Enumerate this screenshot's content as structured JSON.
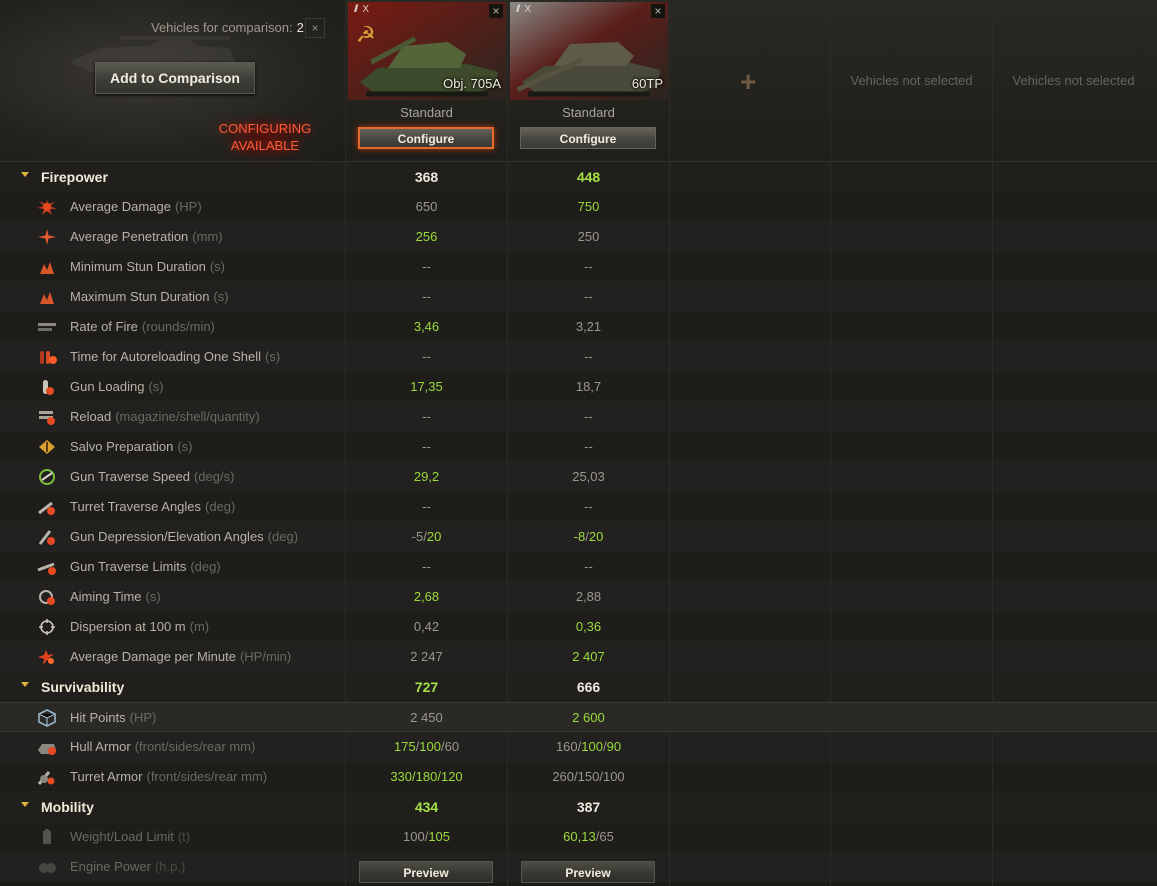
{
  "header": {
    "vehicles_label": "Vehicles for comparison:",
    "vehicles_count": "2",
    "clear_icon": "×",
    "add_button": "Add to Comparison",
    "configuring_line1": "CONFIGURING",
    "configuring_line2": "AVAILABLE",
    "add_slot_icon": "+",
    "empty_slot_text": "Vehicles not selected"
  },
  "vehicles": [
    {
      "tier": "X",
      "name": "Obj. 705A",
      "config": "Standard",
      "configure_button": "Configure",
      "preview_button": "Preview",
      "close_icon": "×",
      "flag": "ussr"
    },
    {
      "tier": "X",
      "name": "60TP",
      "config": "Standard",
      "configure_button": "Configure",
      "preview_button": "Preview",
      "close_icon": "×",
      "flag": "poland"
    }
  ],
  "colors": {
    "better": "#9bdb3a",
    "neutral": "#9a978d",
    "accent": "#e1b640",
    "highlight": "#e36a2c"
  },
  "rows": [
    {
      "type": "section",
      "label": "Firepower",
      "v1": [
        {
          "t": "368",
          "c": "w"
        }
      ],
      "v2": [
        {
          "t": "448",
          "c": "g"
        }
      ]
    },
    {
      "type": "stat",
      "icon": "damage-icon",
      "label": "Average Damage",
      "unit": "(HP)",
      "v1": [
        {
          "t": "650",
          "c": "w"
        }
      ],
      "v2": [
        {
          "t": "750",
          "c": "g"
        }
      ]
    },
    {
      "type": "stat",
      "icon": "penetration-icon",
      "label": "Average Penetration",
      "unit": "(mm)",
      "v1": [
        {
          "t": "256",
          "c": "g"
        }
      ],
      "v2": [
        {
          "t": "250",
          "c": "w"
        }
      ]
    },
    {
      "type": "stat",
      "icon": "stun-min-icon",
      "label": "Minimum Stun Duration",
      "unit": "(s)",
      "v1": [
        {
          "t": "--",
          "c": "w"
        }
      ],
      "v2": [
        {
          "t": "--",
          "c": "w"
        }
      ]
    },
    {
      "type": "stat",
      "icon": "stun-max-icon",
      "label": "Maximum Stun Duration",
      "unit": "(s)",
      "v1": [
        {
          "t": "--",
          "c": "w"
        }
      ],
      "v2": [
        {
          "t": "--",
          "c": "w"
        }
      ]
    },
    {
      "type": "stat",
      "icon": "rate-of-fire-icon",
      "label": "Rate of Fire",
      "unit": "(rounds/min)",
      "v1": [
        {
          "t": "3,46",
          "c": "g"
        }
      ],
      "v2": [
        {
          "t": "3,21",
          "c": "w"
        }
      ]
    },
    {
      "type": "stat",
      "icon": "autoreload-icon",
      "label": "Time for Autoreloading One Shell",
      "unit": "(s)",
      "v1": [
        {
          "t": "--",
          "c": "w"
        }
      ],
      "v2": [
        {
          "t": "--",
          "c": "w"
        }
      ]
    },
    {
      "type": "stat",
      "icon": "gun-loading-icon",
      "label": "Gun Loading",
      "unit": "(s)",
      "v1": [
        {
          "t": "17,35",
          "c": "g"
        }
      ],
      "v2": [
        {
          "t": "18,7",
          "c": "w"
        }
      ]
    },
    {
      "type": "stat",
      "icon": "reload-magazine-icon",
      "label": "Reload",
      "unit": "(magazine/shell/quantity)",
      "v1": [
        {
          "t": "--",
          "c": "w"
        }
      ],
      "v2": [
        {
          "t": "--",
          "c": "w"
        }
      ]
    },
    {
      "type": "stat",
      "icon": "salvo-icon",
      "label": "Salvo Preparation",
      "unit": "(s)",
      "v1": [
        {
          "t": "--",
          "c": "w"
        }
      ],
      "v2": [
        {
          "t": "--",
          "c": "w"
        }
      ]
    },
    {
      "type": "stat",
      "icon": "gun-traverse-icon",
      "label": "Gun Traverse Speed",
      "unit": "(deg/s)",
      "v1": [
        {
          "t": "29,2",
          "c": "g"
        }
      ],
      "v2": [
        {
          "t": "25,03",
          "c": "w"
        }
      ]
    },
    {
      "type": "stat",
      "icon": "turret-angles-icon",
      "label": "Turret Traverse Angles",
      "unit": "(deg)",
      "v1": [
        {
          "t": "--",
          "c": "w"
        }
      ],
      "v2": [
        {
          "t": "--",
          "c": "w"
        }
      ]
    },
    {
      "type": "stat",
      "icon": "elevation-icon",
      "label": "Gun Depression/Elevation Angles",
      "unit": "(deg)",
      "v1": [
        {
          "t": "-5",
          "c": "w"
        },
        {
          "t": "/",
          "c": "w"
        },
        {
          "t": "20",
          "c": "g"
        }
      ],
      "v2": [
        {
          "t": "-8",
          "c": "g"
        },
        {
          "t": "/",
          "c": "w"
        },
        {
          "t": "20",
          "c": "g"
        }
      ]
    },
    {
      "type": "stat",
      "icon": "traverse-limits-icon",
      "label": "Gun Traverse Limits",
      "unit": "(deg)",
      "v1": [
        {
          "t": "--",
          "c": "w"
        }
      ],
      "v2": [
        {
          "t": "--",
          "c": "w"
        }
      ]
    },
    {
      "type": "stat",
      "icon": "aiming-time-icon",
      "label": "Aiming Time",
      "unit": "(s)",
      "v1": [
        {
          "t": "2,68",
          "c": "g"
        }
      ],
      "v2": [
        {
          "t": "2,88",
          "c": "w"
        }
      ]
    },
    {
      "type": "stat",
      "icon": "dispersion-icon",
      "label": "Dispersion at 100 m",
      "unit": "(m)",
      "v1": [
        {
          "t": "0,42",
          "c": "w"
        }
      ],
      "v2": [
        {
          "t": "0,36",
          "c": "g"
        }
      ]
    },
    {
      "type": "stat",
      "icon": "dpm-icon",
      "label": "Average Damage per Minute",
      "unit": "(HP/min)",
      "v1": [
        {
          "t": "2 247",
          "c": "w"
        }
      ],
      "v2": [
        {
          "t": "2 407",
          "c": "g"
        }
      ]
    },
    {
      "type": "section",
      "label": "Survivability",
      "v1": [
        {
          "t": "727",
          "c": "g"
        }
      ],
      "v2": [
        {
          "t": "666",
          "c": "w"
        }
      ]
    },
    {
      "type": "stat",
      "icon": "hit-points-icon",
      "label": "Hit Points",
      "unit": "(HP)",
      "hover": true,
      "v1": [
        {
          "t": "2 450",
          "c": "w"
        }
      ],
      "v2": [
        {
          "t": "2 600",
          "c": "g"
        }
      ]
    },
    {
      "type": "stat",
      "icon": "hull-armor-icon",
      "label": "Hull Armor",
      "unit": "(front/sides/rear mm)",
      "v1": [
        {
          "t": "175",
          "c": "g"
        },
        {
          "t": "/",
          "c": "w"
        },
        {
          "t": "100",
          "c": "g"
        },
        {
          "t": "/",
          "c": "w"
        },
        {
          "t": "60",
          "c": "w"
        }
      ],
      "v2": [
        {
          "t": "160",
          "c": "w"
        },
        {
          "t": "/",
          "c": "w"
        },
        {
          "t": "100",
          "c": "g"
        },
        {
          "t": "/",
          "c": "w"
        },
        {
          "t": "90",
          "c": "g"
        }
      ]
    },
    {
      "type": "stat",
      "icon": "turret-armor-icon",
      "label": "Turret Armor",
      "unit": "(front/sides/rear mm)",
      "v1": [
        {
          "t": "330",
          "c": "g"
        },
        {
          "t": "/",
          "c": "g"
        },
        {
          "t": "180",
          "c": "g"
        },
        {
          "t": "/",
          "c": "g"
        },
        {
          "t": "120",
          "c": "g"
        }
      ],
      "v2": [
        {
          "t": "260",
          "c": "w"
        },
        {
          "t": "/",
          "c": "w"
        },
        {
          "t": "150",
          "c": "w"
        },
        {
          "t": "/",
          "c": "w"
        },
        {
          "t": "100",
          "c": "w"
        }
      ]
    },
    {
      "type": "section",
      "label": "Mobility",
      "v1": [
        {
          "t": "434",
          "c": "g"
        }
      ],
      "v2": [
        {
          "t": "387",
          "c": "w"
        }
      ]
    },
    {
      "type": "stat",
      "icon": "weight-icon",
      "label": "Weight/Load Limit",
      "unit": "(t)",
      "dim": true,
      "v1": [
        {
          "t": "100",
          "c": "w"
        },
        {
          "t": "/",
          "c": "w"
        },
        {
          "t": "105",
          "c": "g"
        }
      ],
      "v2": [
        {
          "t": "60,13",
          "c": "g"
        },
        {
          "t": "/",
          "c": "w"
        },
        {
          "t": "65",
          "c": "w"
        }
      ]
    },
    {
      "type": "stat",
      "icon": "engine-power-icon",
      "label": "Engine Power",
      "unit": "(h.p.)",
      "dim": true,
      "v1": [],
      "v2": []
    }
  ]
}
